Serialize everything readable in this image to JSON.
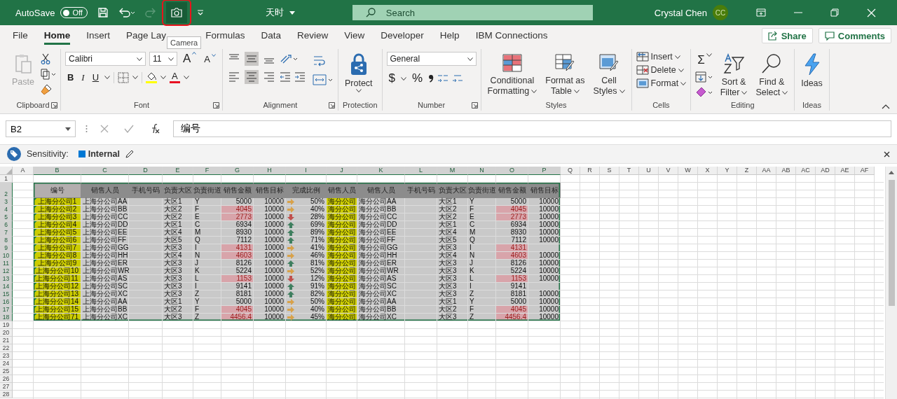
{
  "title_bar": {
    "autosave_label": "AutoSave",
    "autosave": {
      "on": false,
      "label": "Off"
    },
    "redo_disabled": true,
    "camera_highlighted": true,
    "document_title": "天时",
    "search_placeholder": "Search",
    "user_name": "Crystal Chen",
    "user_initials": "CC"
  },
  "camera_tooltip": "Camera",
  "tabs": [
    {
      "label": "File",
      "selected": false
    },
    {
      "label": "Home",
      "selected": true
    },
    {
      "label": "Insert",
      "selected": false
    },
    {
      "label": "Page Lay",
      "selected": false
    },
    {
      "label": "Formulas",
      "selected": false
    },
    {
      "label": "Data",
      "selected": false
    },
    {
      "label": "Review",
      "selected": false
    },
    {
      "label": "View",
      "selected": false
    },
    {
      "label": "Developer",
      "selected": false
    },
    {
      "label": "Help",
      "selected": false
    },
    {
      "label": "IBM Connections",
      "selected": false
    }
  ],
  "share_button": "Share",
  "comments_button": "Comments",
  "ribbon": {
    "clipboard": {
      "label": "Clipboard",
      "paste": {
        "label": "Paste",
        "disabled": true
      }
    },
    "font": {
      "label": "Font",
      "font_name": "Calibri",
      "font_size": "11",
      "grow_glyph": "A",
      "shrink_glyph": "A",
      "bold": "B",
      "italic": "I",
      "underline": "U",
      "font_color_glyph": "A"
    },
    "alignment": {
      "label": "Alignment",
      "vertical": [
        {
          "selected": false
        },
        {
          "selected": true
        },
        {
          "selected": false
        }
      ],
      "horizontal": [
        {
          "selected": false
        },
        {
          "selected": true
        },
        {
          "selected": false
        }
      ]
    },
    "protection": {
      "label": "Protection",
      "protect": "Protect"
    },
    "number": {
      "label": "Number",
      "format": "General",
      "currency": "$",
      "percent": "%"
    },
    "styles": {
      "label": "Styles",
      "buttons": [
        {
          "line1": "Conditional",
          "line2": "Formatting"
        },
        {
          "line1": "Format as",
          "line2": "Table"
        },
        {
          "line1": "Cell",
          "line2": "Styles"
        }
      ]
    },
    "cells": {
      "label": "Cells",
      "buttons": [
        "Insert",
        "Delete",
        "Format"
      ]
    },
    "editing": {
      "label": "Editing",
      "autosum": "Σ",
      "sort": {
        "line1": "Sort &",
        "line2": "Filter"
      },
      "find": {
        "line1": "Find &",
        "line2": "Select"
      }
    },
    "ideas": {
      "label": "Ideas",
      "button": "Ideas"
    }
  },
  "formula_bar": {
    "name_box": "B2",
    "formula": "编号"
  },
  "sensitivity": {
    "label": "Sensitivity:",
    "value": "Internal"
  },
  "sheet": {
    "columns": [
      {
        "label": "A",
        "selected": false
      },
      {
        "label": "B",
        "selected": true
      },
      {
        "label": "C",
        "selected": true
      },
      {
        "label": "D",
        "selected": true
      },
      {
        "label": "E",
        "selected": true
      },
      {
        "label": "F",
        "selected": true
      },
      {
        "label": "G",
        "selected": true
      },
      {
        "label": "H",
        "selected": true
      },
      {
        "label": "I",
        "selected": true
      },
      {
        "label": "J",
        "selected": true
      },
      {
        "label": "K",
        "selected": true
      },
      {
        "label": "L",
        "selected": true
      },
      {
        "label": "M",
        "selected": true
      },
      {
        "label": "N",
        "selected": true
      },
      {
        "label": "O",
        "selected": true
      },
      {
        "label": "P",
        "selected": true
      },
      {
        "label": "Q",
        "selected": false
      },
      {
        "label": "R",
        "selected": false
      },
      {
        "label": "S",
        "selected": false
      },
      {
        "label": "T",
        "selected": false
      },
      {
        "label": "U",
        "selected": false
      },
      {
        "label": "V",
        "selected": false
      },
      {
        "label": "W",
        "selected": false
      },
      {
        "label": "X",
        "selected": false
      },
      {
        "label": "Y",
        "selected": false
      },
      {
        "label": "Z",
        "selected": false
      },
      {
        "label": "AA",
        "selected": false
      },
      {
        "label": "AB",
        "selected": false
      },
      {
        "label": "AC",
        "selected": false
      },
      {
        "label": "AD",
        "selected": false
      },
      {
        "label": "AE",
        "selected": false
      },
      {
        "label": "AF",
        "selected": false
      }
    ],
    "rows": [
      {
        "label": "1",
        "selected": false
      },
      {
        "label": "2",
        "selected": true
      },
      {
        "label": "3",
        "selected": true
      },
      {
        "label": "4",
        "selected": true
      },
      {
        "label": "5",
        "selected": true
      },
      {
        "label": "6",
        "selected": true
      },
      {
        "label": "7",
        "selected": true
      },
      {
        "label": "8",
        "selected": true
      },
      {
        "label": "9",
        "selected": true
      },
      {
        "label": "10",
        "selected": true
      },
      {
        "label": "11",
        "selected": true
      },
      {
        "label": "12",
        "selected": true
      },
      {
        "label": "13",
        "selected": true
      },
      {
        "label": "14",
        "selected": true
      },
      {
        "label": "15",
        "selected": true
      },
      {
        "label": "16",
        "selected": true
      },
      {
        "label": "17",
        "selected": true
      },
      {
        "label": "18",
        "selected": true
      },
      {
        "label": "19",
        "selected": false
      },
      {
        "label": "20",
        "selected": false
      },
      {
        "label": "21",
        "selected": false
      },
      {
        "label": "22",
        "selected": false
      },
      {
        "label": "23",
        "selected": false
      },
      {
        "label": "24",
        "selected": false
      },
      {
        "label": "25",
        "selected": false
      },
      {
        "label": "26",
        "selected": false
      },
      {
        "label": "27",
        "selected": false
      },
      {
        "label": "28",
        "selected": false
      }
    ],
    "table": {
      "headers": [
        {
          "text": "编号",
          "kind": "key"
        },
        {
          "text": "销售人员",
          "kind": "column"
        },
        {
          "text": "手机号码",
          "kind": "column"
        },
        {
          "text": "负责大区",
          "kind": "column"
        },
        {
          "text": "负责街道",
          "kind": "column"
        },
        {
          "text": "销售金额",
          "kind": "column"
        },
        {
          "text": "销售目标",
          "kind": "column"
        },
        {
          "text": "完成比例",
          "kind": "column"
        },
        {
          "text": "销售人员",
          "kind": "column"
        },
        {
          "text": "销售人员",
          "kind": "column"
        },
        {
          "text": "手机号码",
          "kind": "column"
        },
        {
          "text": "负责大区",
          "kind": "column"
        },
        {
          "text": "负责街道",
          "kind": "column"
        },
        {
          "text": "销售金额",
          "kind": "column"
        },
        {
          "text": "销售目标",
          "kind": "column"
        }
      ],
      "records": [
        {
          "id": "上海分公司1",
          "error_mark": true,
          "salesperson": "上海分公司AA",
          "region": "大区1",
          "street": "Y",
          "amount": "5000",
          "below_target": false,
          "target": "10000",
          "arrow": {
            "kind": "right"
          },
          "ratio": "50%",
          "copy_id": "海分公司",
          "copy_salesperson": "海分公司AA",
          "copy_region": "大区1",
          "copy_street": "Y",
          "copy_amount": "5000",
          "copy_below_target": false,
          "copy_target": "10000"
        },
        {
          "id": "上海分公司2",
          "error_mark": true,
          "salesperson": "上海分公司BB",
          "region": "大区2",
          "street": "F",
          "amount": "4045",
          "below_target": true,
          "target": "10000",
          "arrow": {
            "kind": "right"
          },
          "ratio": "40%",
          "copy_id": "海分公司",
          "copy_salesperson": "海分公司BB",
          "copy_region": "大区2",
          "copy_street": "F",
          "copy_amount": "4045",
          "copy_below_target": true,
          "copy_target": "10000"
        },
        {
          "id": "上海分公司3",
          "error_mark": true,
          "salesperson": "上海分公司CC",
          "region": "大区2",
          "street": "E",
          "amount": "2773",
          "below_target": true,
          "target": "10000",
          "arrow": {
            "kind": "down"
          },
          "ratio": "28%",
          "copy_id": "海分公司",
          "copy_salesperson": "海分公司CC",
          "copy_region": "大区2",
          "copy_street": "E",
          "copy_amount": "2773",
          "copy_below_target": true,
          "copy_target": "10000"
        },
        {
          "id": "上海分公司4",
          "error_mark": true,
          "salesperson": "上海分公司DD",
          "region": "大区1",
          "street": "C",
          "amount": "6934",
          "below_target": false,
          "target": "10000",
          "arrow": {
            "kind": "up"
          },
          "ratio": "69%",
          "copy_id": "海分公司",
          "copy_salesperson": "海分公司DD",
          "copy_region": "大区1",
          "copy_street": "C",
          "copy_amount": "6934",
          "copy_below_target": false,
          "copy_target": "10000"
        },
        {
          "id": "上海分公司5",
          "error_mark": true,
          "salesperson": "上海分公司EE",
          "region": "大区4",
          "street": "M",
          "amount": "8930",
          "below_target": false,
          "target": "10000",
          "arrow": {
            "kind": "up"
          },
          "ratio": "89%",
          "copy_id": "海分公司",
          "copy_salesperson": "海分公司EE",
          "copy_region": "大区4",
          "copy_street": "M",
          "copy_amount": "8930",
          "copy_below_target": false,
          "copy_target": "10000"
        },
        {
          "id": "上海分公司6",
          "error_mark": true,
          "salesperson": "上海分公司FF",
          "region": "大区5",
          "street": "Q",
          "amount": "7112",
          "below_target": false,
          "target": "10000",
          "arrow": {
            "kind": "up"
          },
          "ratio": "71%",
          "copy_id": "海分公司",
          "copy_salesperson": "海分公司FF",
          "copy_region": "大区5",
          "copy_street": "Q",
          "copy_amount": "7112",
          "copy_below_target": false,
          "copy_target": "10000"
        },
        {
          "id": "上海分公司7",
          "error_mark": true,
          "salesperson": "上海分公司GG",
          "region": "大区3",
          "street": "I",
          "amount": "4131",
          "below_target": true,
          "target": "10000",
          "arrow": {
            "kind": "right"
          },
          "ratio": "41%",
          "copy_id": "海分公司",
          "copy_salesperson": "海分公司GG",
          "copy_region": "大区3",
          "copy_street": "I",
          "copy_amount": "4131",
          "copy_below_target": true
        },
        {
          "id": "上海分公司8",
          "error_mark": true,
          "salesperson": "上海分公司HH",
          "region": "大区4",
          "street": "N",
          "amount": "4603",
          "below_target": true,
          "target": "10000",
          "arrow": {
            "kind": "right"
          },
          "ratio": "46%",
          "copy_id": "海分公司",
          "copy_salesperson": "海分公司HH",
          "copy_region": "大区4",
          "copy_street": "N",
          "copy_amount": "4603",
          "copy_below_target": true,
          "copy_target": "10000"
        },
        {
          "id": "上海分公司9",
          "error_mark": true,
          "salesperson": "上海分公司ER",
          "region": "大区3",
          "street": "J",
          "amount": "8126",
          "below_target": false,
          "target": "10000",
          "arrow": {
            "kind": "up"
          },
          "ratio": "81%",
          "copy_id": "海分公司",
          "copy_salesperson": "海分公司ER",
          "copy_region": "大区3",
          "copy_street": "J",
          "copy_amount": "8126",
          "copy_below_target": false,
          "copy_target": "10000"
        },
        {
          "id": "上海分公司10",
          "error_mark": true,
          "salesperson": "上海分公司WR",
          "region": "大区3",
          "street": "K",
          "amount": "5224",
          "below_target": false,
          "target": "10000",
          "arrow": {
            "kind": "right"
          },
          "ratio": "52%",
          "copy_id": "海分公司",
          "copy_salesperson": "海分公司WR",
          "copy_region": "大区3",
          "copy_street": "K",
          "copy_amount": "5224",
          "copy_below_target": false,
          "copy_target": "10000"
        },
        {
          "id": "上海分公司11",
          "error_mark": true,
          "salesperson": "上海分公司AS",
          "region": "大区3",
          "street": "L",
          "amount": "1153",
          "below_target": true,
          "target": "10000",
          "arrow": {
            "kind": "down"
          },
          "ratio": "12%",
          "copy_id": "海分公司",
          "copy_salesperson": "海分公司AS",
          "copy_region": "大区3",
          "copy_street": "L",
          "copy_amount": "1153",
          "copy_below_target": true,
          "copy_target": "10000"
        },
        {
          "id": "上海分公司12",
          "error_mark": true,
          "salesperson": "上海分公司SC",
          "region": "大区3",
          "street": "I",
          "amount": "9141",
          "below_target": false,
          "target": "10000",
          "arrow": {
            "kind": "up"
          },
          "ratio": "91%",
          "copy_id": "海分公司",
          "copy_salesperson": "海分公司SC",
          "copy_region": "大区3",
          "copy_street": "I",
          "copy_amount": "9141",
          "copy_below_target": false
        },
        {
          "id": "上海分公司13",
          "error_mark": true,
          "salesperson": "上海分公司XC",
          "region": "大区3",
          "street": "Z",
          "amount": "8181",
          "below_target": false,
          "target": "10000",
          "arrow": {
            "kind": "up"
          },
          "ratio": "82%",
          "copy_id": "海分公司",
          "copy_salesperson": "海分公司XC",
          "copy_region": "大区3",
          "copy_street": "Z",
          "copy_amount": "8181",
          "copy_below_target": false,
          "copy_target": "10000"
        },
        {
          "id": "上海分公司14",
          "error_mark": true,
          "salesperson": "上海分公司AA",
          "region": "大区1",
          "street": "Y",
          "amount": "5000",
          "below_target": false,
          "target": "10000",
          "arrow": {
            "kind": "right"
          },
          "ratio": "50%",
          "copy_id": "海分公司",
          "copy_salesperson": "海分公司AA",
          "copy_region": "大区1",
          "copy_street": "Y",
          "copy_amount": "5000",
          "copy_below_target": false,
          "copy_target": "10000"
        },
        {
          "id": "上海分公司15",
          "error_mark": true,
          "salesperson": "上海分公司BB",
          "region": "大区2",
          "street": "F",
          "amount": "4045",
          "below_target": true,
          "target": "10000",
          "arrow": {
            "kind": "right"
          },
          "ratio": "40%",
          "copy_id": "海分公司",
          "copy_salesperson": "海分公司BB",
          "copy_region": "大区2",
          "copy_street": "F",
          "copy_amount": "4045",
          "copy_below_target": true,
          "copy_target": "10000"
        },
        {
          "id": "上海分公司71",
          "error_mark": true,
          "salesperson": "上海分公司XC",
          "region": "大区3",
          "street": "Z",
          "amount": "4456.4",
          "below_target": true,
          "target": "10000",
          "arrow": {
            "kind": "right"
          },
          "ratio": "45%",
          "copy_id": "海分公司",
          "copy_salesperson": "海分公司XC",
          "copy_region": "大区3",
          "copy_street": "Z",
          "copy_amount": "4456.4",
          "copy_below_target": true,
          "copy_target": "10000"
        }
      ]
    }
  }
}
